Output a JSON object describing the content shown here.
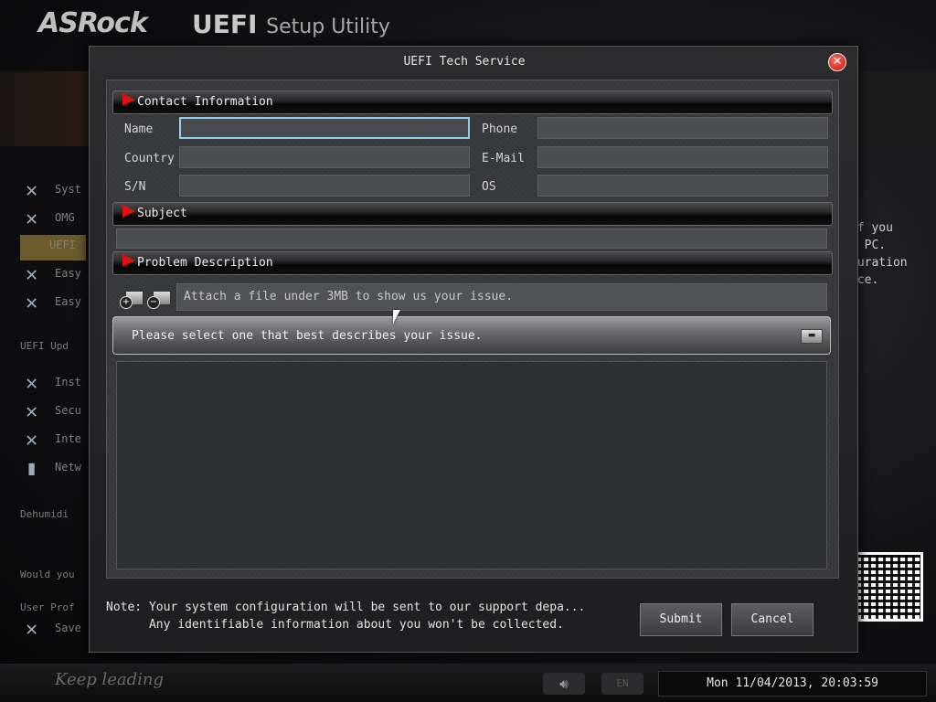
{
  "app": {
    "logo": "ASRock",
    "title_main": "UEFI",
    "title_sub": "Setup Utility"
  },
  "background": {
    "right_text": [
      "if you",
      "r PC.",
      "guration",
      "ice."
    ],
    "side_labels": [
      "Syst",
      "OMG",
      "UEFI",
      "Easy",
      "Easy",
      "Inst",
      "Secu",
      "Inte",
      "Netw"
    ],
    "section_labels": [
      "UEFI Upd",
      "Dehumidi",
      "Would you",
      "User Prof",
      "Save"
    ]
  },
  "modal": {
    "title": "UEFI Tech Service",
    "close_glyph": "✕",
    "sections": {
      "contact": "Contact Information",
      "subject": "Subject",
      "problem": "Problem Description"
    },
    "fields": {
      "name": {
        "label": "Name",
        "value": ""
      },
      "country": {
        "label": "Country",
        "value": ""
      },
      "sn": {
        "label": "S/N",
        "value": ""
      },
      "phone": {
        "label": "Phone",
        "value": ""
      },
      "email": {
        "label": "E-Mail",
        "value": ""
      },
      "os": {
        "label": "OS",
        "value": ""
      },
      "subject": {
        "value": ""
      }
    },
    "attach": {
      "add_icon": "attach-add-icon",
      "remove_icon": "attach-remove-icon",
      "placeholder": "Attach a file under 3MB to show us your issue."
    },
    "issue_select": {
      "value": "Please select one that best describes your issue."
    },
    "note_line1": "Note: Your system configuration will be sent to our support depa...",
    "note_line2": "      Any identifiable information about you won't be collected.",
    "buttons": {
      "submit": "Submit",
      "cancel": "Cancel"
    }
  },
  "taskbar": {
    "volume_icon": "speaker-icon",
    "lang": "EN",
    "datetime": "Mon 11/04/2013, 20:03:59",
    "brand_script": "Keep leading"
  },
  "colors": {
    "accent_red": "#e01010",
    "focus_cyan": "#8fd0e8",
    "close_red": "#c0150a"
  }
}
